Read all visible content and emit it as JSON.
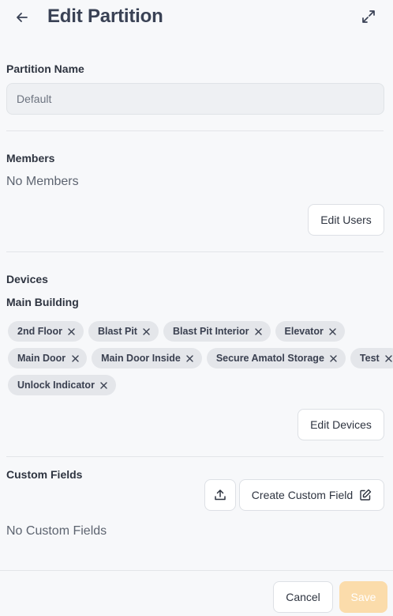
{
  "header": {
    "title": "Edit Partition",
    "back_icon": "arrow-left-icon",
    "expand_icon": "expand-icon"
  },
  "partition_name": {
    "label": "Partition Name",
    "value": "Default"
  },
  "members": {
    "label": "Members",
    "empty_text": "No Members",
    "edit_button": "Edit Users"
  },
  "devices": {
    "label": "Devices",
    "group_label": "Main Building",
    "chips": [
      "2nd Floor",
      "Blast Pit",
      "Blast Pit Interior",
      "Elevator",
      "Main Door",
      "Main Door Inside",
      "Secure Amatol Storage",
      "Test",
      "Unlock Indicator"
    ],
    "edit_button": "Edit Devices"
  },
  "custom_fields": {
    "label": "Custom Fields",
    "upload_icon": "upload-icon",
    "create_button": "Create Custom Field",
    "create_icon": "edit-icon",
    "empty_text": "No Custom Fields"
  },
  "footer": {
    "cancel_button": "Cancel",
    "save_button": "Save",
    "save_color": "#fbdcab"
  }
}
